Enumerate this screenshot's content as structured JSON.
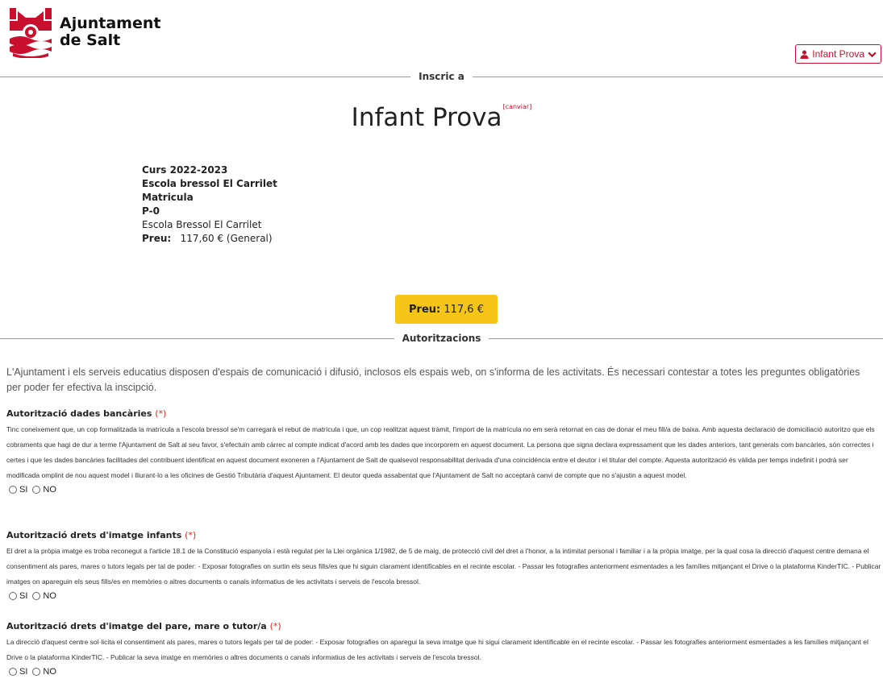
{
  "header": {
    "logo_line1": "Ajuntament",
    "logo_line2": "de Salt",
    "user_label": "Infant Prova"
  },
  "enroll": {
    "divider_label": "Inscric a",
    "child_name": "Infant Prova",
    "change_link": "[canviar]"
  },
  "course": {
    "year": "Curs 2022-2023",
    "school": "Escola bressol El Carrilet",
    "type": "Matricula",
    "group": "P-0",
    "center": "Escola Bressol El Carrilet",
    "price_label": "Preu:",
    "price_value": "117,60 € (General)"
  },
  "price_button": {
    "label": "Preu:",
    "value": "117,6 €"
  },
  "authorizations": {
    "divider_label": "Autoritzacions",
    "intro": "L'Ajuntament i els serveis educatius disposen d'espais de comunicació i difusió, inclosos els espais web, on s'informa de les activitats. És necessari contestar a totes les preguntes obligatòries per poder fer efectiva la inscipció.",
    "required_mark": "(*)",
    "yes_label": "SI",
    "no_label": "NO",
    "items": [
      {
        "title": "Autorització dades bancàries",
        "text": "Tinc coneixement que, un cop formalitzada la matrícula a l'escola bressol se'm carregarà el rebut de matrícula i que, un cop realitzat aquest tràmit, l'import de la matrícula no em serà retornat en cas de donar el meu fill/a de baixa. Amb aquesta declaració de domiciliació autoritzo que els cobraments que hagi de dur a terme l'Ajuntament de Salt al seu favor, s'efectuïn amb càrrec al compte indicat d'acord amb les dades que incorporem en aquest document. La persona que signa declara expressament que les dades anteriors, tant generals com bancàries, són correctes i certes i que les dades bancàries facilitades del contribuent identificat en aquest document exoneren a l'Ajuntament de Salt de qualsevol responsabilitat derivada d'una coincidència entre el deutor i el titular del compte. Aquesta autorització és vàlida per temps indefinit i podrà ser modificada omplint de nou aquest model i lliurant-lo a les oficines de Gestió Tributària d'aquest Ajuntament. El deutor queda assabentat que l'Ajuntament de Salt no acceptarà canvi de compte que no s'ajustin a aquest model."
      },
      {
        "title": "Autorització drets d'imatge infants",
        "text": "El dret a la pròpia imatge es troba reconegut a l'article 18.1 de la Constitució espanyola i està regulat per la Llei orgànica 1/1982, de 5 de maig, de protecció civil del dret a l'honor, a la intimitat personal i familiar i a la pròpia imatge, per la qual cosa la direcció d'aquest centre demana el consentiment als pares, mares o tutors legals per tal de poder: - Exposar fotografies on surtin els seus fills/es que hi siguin clarament identificables en el recinte escolar. - Passar les fotografies anteriorment esmentades a les famílies mitjançant el Drive o la plataforma KinderTIC. - Publicar imatges on apareguin els seus fills/es en memòries o altres documents o canals informatius de les activitats i serveis de l'escola bressol."
      },
      {
        "title": "Autorització drets d'imatge del pare, mare o tutor/a",
        "text": "La direcció d'aquest centre sol·licita el consentiment als pares, mares o tutors legals per tal de poder: - Exposar fotografies on aparegui la seva imatge que hi sigui clarament identificable en el recinte escolar. - Passar les fotografies anteriorment esmentades a les famílies mitjançant el Drive o la plataforma KinderTIC. - Publicar la seva imatge en memòries o altres documents o canals informatius de les activitats i serveis de l'escola bressol."
      }
    ]
  },
  "colors": {
    "brand_red": "#c8102e",
    "price_yellow": "#f5c518"
  },
  "icons": {
    "logo": "ajuntament-salt-logo",
    "user": "user-icon",
    "chevron": "chevron-down-icon"
  }
}
